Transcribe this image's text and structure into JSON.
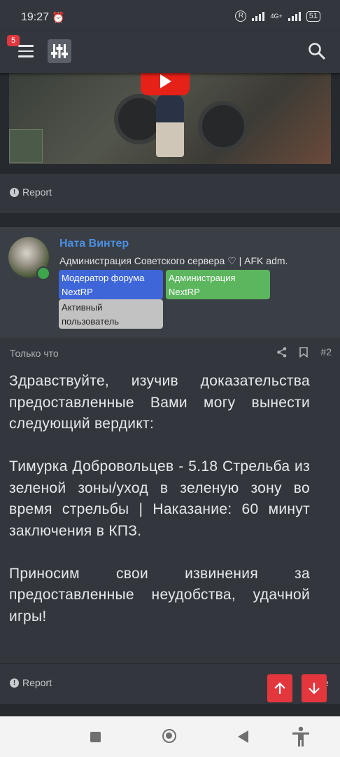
{
  "status_bar": {
    "time": "19:27",
    "alarm_icon": "alarm-icon",
    "r_badge": "R",
    "signal1_label": "4G+",
    "battery": "51"
  },
  "app_bar": {
    "notifications_count": "5",
    "menu_icon": "hamburger-icon",
    "logo_icon": "sliders-logo-icon",
    "search_icon": "search-icon"
  },
  "first_post": {
    "report_label": "Report"
  },
  "post": {
    "username": "Ната Винтер",
    "user_title": "Администрация Советского сервера ♡ | AFK adm.",
    "banners": {
      "moderator": "Модератор форума NextRP",
      "administration": "Администрация NextRP",
      "active": "Активный пользователь"
    },
    "time": "Только что",
    "post_number": "#2",
    "body": {
      "p1": "Здравствуйте, изучив доказательства предоставленные Вами могу вынести следующий вердикт:",
      "p2": "Тимурка Добровольцев - 5.18 Стрельба из зеленой зоны/уход в зеленую зону во время стрельбы | Наказание: 60 минут заключения в КПЗ.",
      "p3": "Приносим свои извинения за предоставленные неудобства, удачной игры!"
    },
    "report_label": "Report",
    "like_partial": "e"
  },
  "colors": {
    "accent_blue": "#4a90e2",
    "moderator_banner": "#3e66d8",
    "admin_banner": "#5cb65e",
    "scroll_button": "#e3363d"
  }
}
